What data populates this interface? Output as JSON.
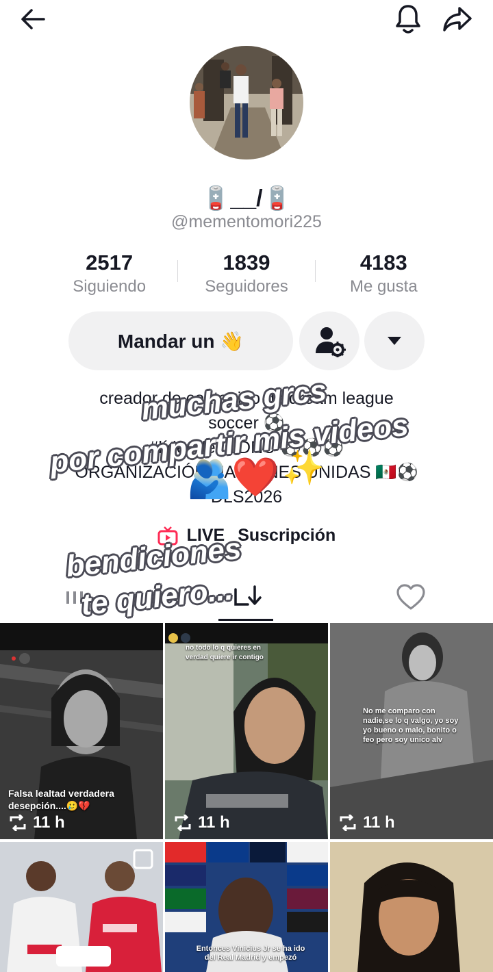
{
  "header": {
    "back_icon": "arrow-left-icon",
    "bell_icon": "bell-icon",
    "share_icon": "share-arrow-icon"
  },
  "profile": {
    "display_name": "🪫__/🪫",
    "username": "@mementomori225"
  },
  "stats": [
    {
      "value": "2517",
      "label": "Siguiendo"
    },
    {
      "value": "1839",
      "label": "Seguidores"
    },
    {
      "value": "4183",
      "label": "Me gusta"
    }
  ],
  "actions": {
    "message_label": "Mandar un 👋",
    "follow_icon": "user-settings-icon",
    "more_icon": "caret-down-icon"
  },
  "bio": {
    "line1": "creador de contenido de dream league",
    "line2": "soccer ⚽",
    "line3": "#líder de la DNU ⚽⚽⚽",
    "line4": "ORGANIZACIÓN NACIONES UNIDAS 🇲🇽⚽",
    "line5": "DLS2026"
  },
  "live": {
    "icon": "tv-icon",
    "label": "LIVE",
    "subscription": "Suscripción"
  },
  "tabs": [
    {
      "icon": "grid-icon"
    },
    {
      "icon": "repost-icon"
    },
    {
      "icon": "heart-outline-icon"
    }
  ],
  "videos": [
    {
      "count": "11 h",
      "caption": "Falsa lealtad verdadera desepción....🥲💔"
    },
    {
      "count": "11 h",
      "caption": "no todo lo q quieres en verdad quiere ir contigo"
    },
    {
      "count": "11 h",
      "caption": "No me comparo con nadie,se lo q valgo, yo soy yo bueno o malo, bonito o feo pero soy unico alv"
    },
    {
      "count": "",
      "caption": ""
    },
    {
      "count": "",
      "caption": "Entonces Vinicius Jr se ha ido del Real Madrid y empezó"
    },
    {
      "count": "",
      "caption": ""
    }
  ],
  "overlay": {
    "line1": "muchas grcs",
    "line2": "por compartir mis videos",
    "line3": "bendiciones",
    "line4": "te quiero...",
    "emoji1": "🫂",
    "emoji2": "❤️",
    "emoji3": "✨"
  }
}
